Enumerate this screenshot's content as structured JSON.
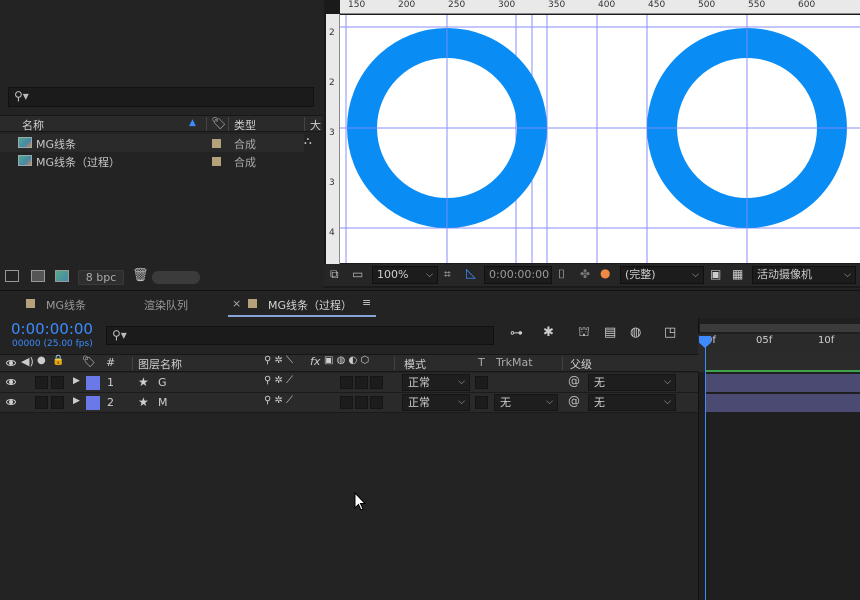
{
  "project": {
    "search_placeholder": "",
    "columns": {
      "name": "名称",
      "type": "类型",
      "more": "大"
    },
    "items": [
      {
        "name": "MG线条",
        "type": "合成"
      },
      {
        "name": "MG线条（过程）",
        "type": "合成"
      }
    ],
    "footer": {
      "bpc": "8 bpc"
    }
  },
  "viewer": {
    "ruler_labels": [
      "150",
      "200",
      "250",
      "300",
      "350",
      "400",
      "450",
      "500",
      "550",
      "600"
    ],
    "ruler_left_labels": [
      "2",
      "2",
      "3",
      "3",
      "4"
    ],
    "zoom": "100%",
    "timecode": "0:00:00:00",
    "resolution": "(完整)",
    "camera": "活动摄像机",
    "ring_color": "#0a8cf5",
    "guide_color": "#8c8cff"
  },
  "tabs": [
    {
      "label": "MG线条"
    },
    {
      "label": "渲染队列"
    },
    {
      "label": "MG线条（过程）",
      "close": "×",
      "menu": "≡"
    }
  ],
  "timeline": {
    "current_time": "0:00:00:00",
    "frame_info": "00000 (25.00 fps)",
    "search_placeholder": "",
    "columns": {
      "hash": "#",
      "layer_name": "图层名称",
      "fx": "fx",
      "mode": "模式",
      "t": "T",
      "trkmat": "TrkMat",
      "parent": "父级"
    },
    "layers": [
      {
        "index": "1",
        "name": "G",
        "mode": "正常",
        "trkmat": "",
        "parent": "无",
        "label_color": "#6a78e8"
      },
      {
        "index": "2",
        "name": "M",
        "mode": "正常",
        "trkmat": "无",
        "parent": "无",
        "label_color": "#6a78e8"
      }
    ],
    "time_ruler": {
      "t0": "0f",
      "t1": "05f",
      "t2": "10f"
    }
  }
}
